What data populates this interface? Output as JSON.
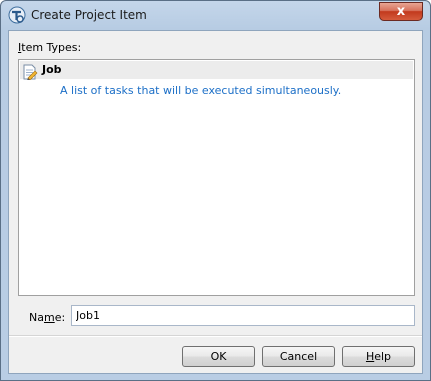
{
  "window": {
    "title": "Create Project Item",
    "close_glyph": "x",
    "app_icon": "app-logo-icon"
  },
  "item_types": {
    "label_prefix": "",
    "label_mnemonic": "I",
    "label_rest": "tem Types:",
    "items": [
      {
        "icon": "job-icon",
        "name": "Job",
        "description": "A list of tasks that will be executed simultaneously.",
        "selected": true
      }
    ]
  },
  "name_field": {
    "label_prefix": "Na",
    "label_mnemonic": "m",
    "label_rest": "e:",
    "value": "Job1"
  },
  "buttons": {
    "ok": "OK",
    "cancel": "Cancel",
    "help_mnemonic": "H",
    "help_rest": "elp"
  },
  "colors": {
    "description_text": "#1c6fc7",
    "close_button": "#c2391d"
  }
}
